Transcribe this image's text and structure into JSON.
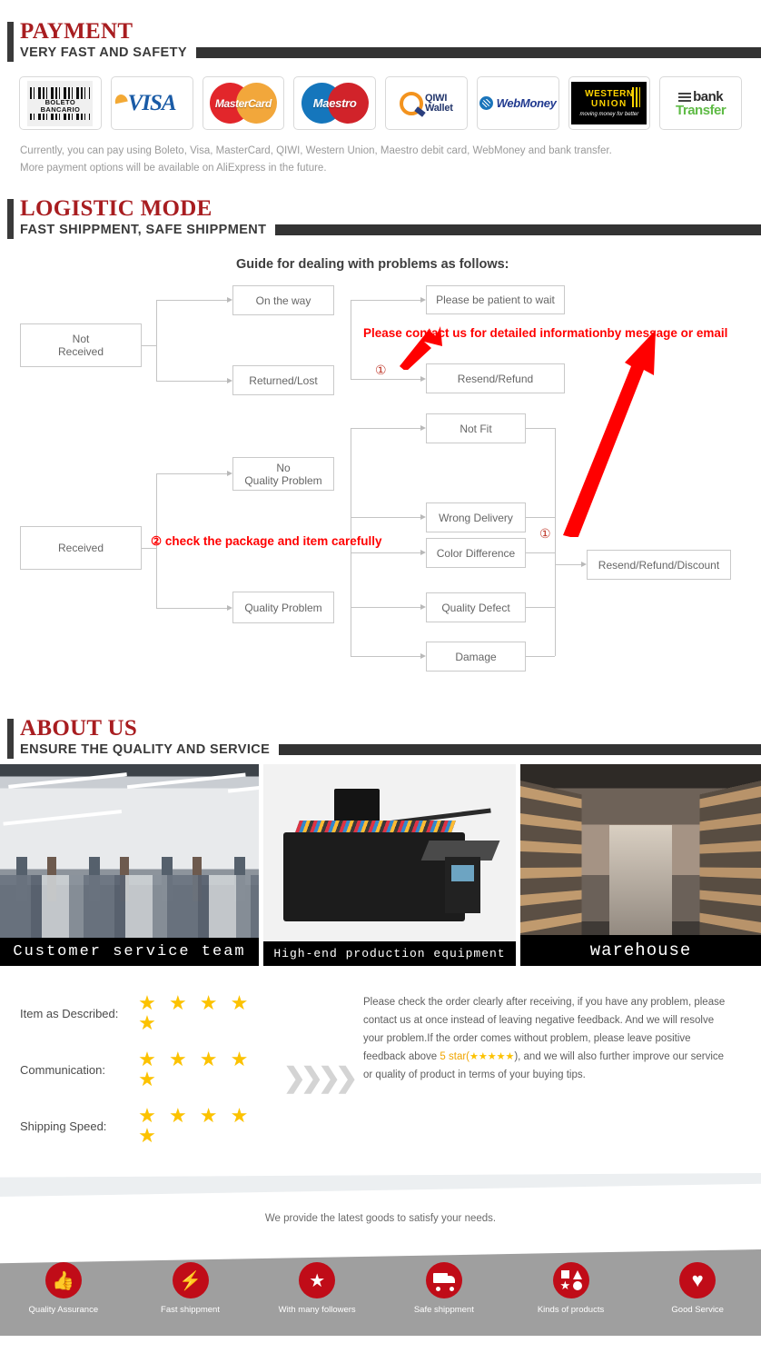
{
  "sections": {
    "payment": {
      "title": "PAYMENT",
      "subtitle": "VERY FAST AND SAFETY",
      "logos": [
        {
          "name": "boleto-bancario-logo",
          "line1": "BOLETO",
          "line2": "BANCARIO"
        },
        {
          "name": "visa-logo",
          "text": "VISA"
        },
        {
          "name": "mastercard-logo",
          "text": "MasterCard"
        },
        {
          "name": "maestro-logo",
          "text": "Maestro"
        },
        {
          "name": "qiwi-wallet-logo",
          "line1": "QIWI",
          "line2": "Wallet"
        },
        {
          "name": "webmoney-logo",
          "text": "WebMoney"
        },
        {
          "name": "western-union-logo",
          "line1": "WESTERN",
          "line2": "UNION",
          "line3": "moving money for better"
        },
        {
          "name": "bank-transfer-logo",
          "line1": "bank",
          "line2": "Transfer"
        }
      ],
      "note_line1": "Currently, you can pay using Boleto, Visa, MasterCard, QIWI, Western Union, Maestro debit card, WebMoney and bank transfer.",
      "note_line2": "More payment options will be available on AliExpress in the future."
    },
    "logistic": {
      "title": "LOGISTIC MODE",
      "subtitle": "FAST SHIPPMENT, SAFE SHIPPMENT",
      "guide_title": "Guide for dealing with problems as follows:",
      "boxes": {
        "not_received": "Not\nReceived",
        "on_the_way": "On the way",
        "returned_lost": "Returned/Lost",
        "please_wait": "Please be patient to wait",
        "resend_refund": "Resend/Refund",
        "received": "Received",
        "no_quality_problem": "No\nQuality Problem",
        "quality_problem": "Quality Problem",
        "not_fit": "Not Fit",
        "wrong_delivery": "Wrong Delivery",
        "color_difference": "Color Difference",
        "quality_defect": "Quality Defect",
        "damage": "Damage",
        "resend_refund_discount": "Resend/Refund/Discount"
      },
      "annotations": {
        "contact_note": "Please contact us for detailed informationby message or email",
        "check_note": "check the package and item carefully",
        "marker_one": "①",
        "marker_two": "②"
      }
    },
    "about": {
      "title": "ABOUT US",
      "subtitle": "ENSURE THE QUALITY AND SERVICE",
      "photos": [
        {
          "name": "photo-customer-service-team",
          "caption": "Customer service team"
        },
        {
          "name": "photo-production-equipment",
          "caption": "High-end production equipment"
        },
        {
          "name": "photo-warehouse",
          "caption": "warehouse"
        }
      ],
      "ratings": [
        {
          "label": "Item as Described:",
          "stars": "★ ★ ★ ★ ★",
          "value": 5
        },
        {
          "label": "Communication:",
          "stars": "★ ★ ★ ★ ★",
          "value": 5
        },
        {
          "label": "Shipping Speed:",
          "stars": "★ ★ ★ ★ ★",
          "value": 5
        }
      ],
      "chevrons": "❯❯❯❯",
      "policy": {
        "part1": "Please check the order clearly after receiving, if you have any problem, please contact us at once instead of leaving negative feedback. And we will resolve your problem.If the order comes without problem, please leave positive feedback above ",
        "highlight": "5 star(",
        "ministars": "★★★★★",
        "part2": "), and we will also further improve our service or quality of product in terms of your buying tips."
      }
    },
    "footer": {
      "tagline": "We provide the latest goods to satisfy your needs.",
      "features": [
        {
          "name": "thumbs-up-icon",
          "label": "Quality Assurance",
          "glyph": "👍"
        },
        {
          "name": "lightning-bolt-icon",
          "label": "Fast shippment",
          "glyph": "⚡"
        },
        {
          "name": "star-icon",
          "label": "With many followers",
          "glyph": "★"
        },
        {
          "name": "truck-icon",
          "label": "Safe shippment",
          "glyph": ""
        },
        {
          "name": "shapes-icon",
          "label": "Kinds of products",
          "glyph": ""
        },
        {
          "name": "heart-icon",
          "label": "Good Service",
          "glyph": "♥"
        }
      ]
    }
  },
  "colors": {
    "heading_red": "#a81d20",
    "bar_dark": "#333333",
    "accent_red": "#ff0000",
    "icon_red": "#c00c18",
    "star_gold": "#fcc200",
    "banner_gray": "#9f9f9f"
  }
}
